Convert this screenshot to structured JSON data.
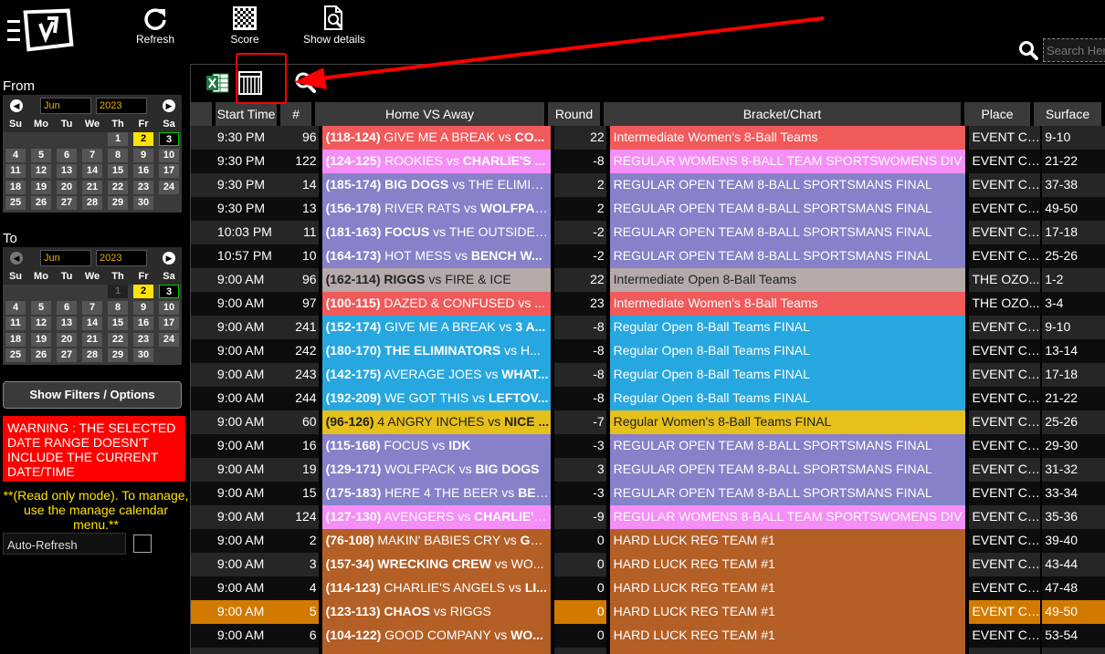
{
  "toolbar": {
    "refresh_label": "Refresh",
    "score_label": "Score",
    "details_label": "Show details",
    "search_placeholder": "Search Here"
  },
  "sidebar": {
    "from_label": "From",
    "to_label": "To",
    "from_calendar": {
      "month": "Jun",
      "year": "2023",
      "days_of_week": [
        "Su",
        "Mo",
        "Tu",
        "We",
        "Th",
        "Fr",
        "Sa"
      ],
      "weeks": [
        [
          "",
          "",
          "",
          "",
          "1",
          "2",
          "3"
        ],
        [
          "4",
          "5",
          "6",
          "7",
          "8",
          "9",
          "10"
        ],
        [
          "11",
          "12",
          "13",
          "14",
          "15",
          "16",
          "17"
        ],
        [
          "18",
          "19",
          "20",
          "21",
          "22",
          "23",
          "24"
        ],
        [
          "25",
          "26",
          "27",
          "28",
          "29",
          "30",
          ""
        ]
      ],
      "selected_day": "3",
      "today_day": "2"
    },
    "to_calendar": {
      "month": "Jun",
      "year": "2023",
      "days_of_week": [
        "Su",
        "Mo",
        "Tu",
        "We",
        "Th",
        "Fr",
        "Sa"
      ],
      "weeks": [
        [
          "",
          "",
          "",
          "",
          "1",
          "2",
          "3"
        ],
        [
          "4",
          "5",
          "6",
          "7",
          "8",
          "9",
          "10"
        ],
        [
          "11",
          "12",
          "13",
          "14",
          "15",
          "16",
          "17"
        ],
        [
          "18",
          "19",
          "20",
          "21",
          "22",
          "23",
          "24"
        ],
        [
          "25",
          "26",
          "27",
          "28",
          "29",
          "30",
          ""
        ]
      ],
      "selected_day": "3",
      "today_day": "2"
    },
    "filters_button": "Show Filters / Options",
    "warning": "WARNING : THE SELECTED DATE RANGE DOESN'T INCLUDE THE CURRENT DATE/TIME",
    "readonly_note": "**(Read only mode). To manage, use the manage calendar menu.**",
    "autorefresh_label": "Auto-Refresh"
  },
  "table": {
    "headers": [
      "",
      "Start Time",
      "#",
      "Home VS Away",
      "Round",
      "Bracket/Chart",
      "Place",
      "Surface"
    ],
    "rows": [
      {
        "time": "9:30 PM",
        "num": "96",
        "ids": "(118-124)",
        "home": "GIVE ME A BREAK",
        "vs": "vs",
        "away": "CO...",
        "round": "22",
        "bracket": "Intermediate Women's 8-Ball Teams",
        "place": "EVENT CE...",
        "surface": "9-10",
        "color": "#f05a5a",
        "bold": "away"
      },
      {
        "time": "9:30 PM",
        "num": "122",
        "ids": "(124-125)",
        "home": "ROOKIES",
        "vs": "vs",
        "away": "CHARLIE'S ...",
        "round": "-8",
        "bracket": "REGULAR WOMENS 8-BALL TEAM SPORTSWOMENS DIV",
        "place": "EVENT CE...",
        "surface": "21-22",
        "color": "#f58ef7",
        "bold": "away"
      },
      {
        "time": "9:30 PM",
        "num": "14",
        "ids": "(185-174)",
        "home": "BIG DOGS",
        "vs": "vs",
        "away": "THE ELIMIN...",
        "round": "2",
        "bracket": "REGULAR OPEN TEAM 8-BALL SPORTSMANS FINAL",
        "place": "EVENT CE...",
        "surface": "37-38",
        "color": "#8681c9",
        "bold": "home"
      },
      {
        "time": "9:30 PM",
        "num": "13",
        "ids": "(156-178)",
        "home": "RIVER RATS",
        "vs": "vs",
        "away": "WOLFPACK",
        "round": "2",
        "bracket": "REGULAR OPEN TEAM 8-BALL SPORTSMANS FINAL",
        "place": "EVENT CE...",
        "surface": "49-50",
        "color": "#8681c9",
        "bold": "away"
      },
      {
        "time": "10:03 PM",
        "num": "11",
        "ids": "(181-163)",
        "home": "FOCUS",
        "vs": "vs",
        "away": "THE OUTSIDERS",
        "round": "-2",
        "bracket": "REGULAR OPEN TEAM 8-BALL SPORTSMANS FINAL",
        "place": "EVENT CE...",
        "surface": "17-18",
        "color": "#8681c9",
        "bold": "home"
      },
      {
        "time": "10:57 PM",
        "num": "10",
        "ids": "(164-173)",
        "home": "HOT MESS",
        "vs": "vs",
        "away": "BENCH W...",
        "round": "-2",
        "bracket": "REGULAR OPEN TEAM 8-BALL SPORTSMANS FINAL",
        "place": "EVENT CE...",
        "surface": "25-26",
        "color": "#8681c9",
        "bold": "away"
      },
      {
        "time": "9:00 AM",
        "num": "96",
        "ids": "(162-114)",
        "home": "RIGGS",
        "vs": "vs",
        "away": "FIRE & ICE",
        "round": "22",
        "bracket": "Intermediate Open 8-Ball Teams",
        "place": "THE OZO...",
        "surface": "1-2",
        "color": "#b6a9a9",
        "bold": "home",
        "dark": true
      },
      {
        "time": "9:00 AM",
        "num": "97",
        "ids": "(100-115)",
        "home": "DAZED & CONFUSED",
        "vs": "vs",
        "away": "...",
        "round": "23",
        "bracket": "Intermediate Women's 8-Ball Teams",
        "place": "THE OZO...",
        "surface": "3-4",
        "color": "#f05a5a",
        "bold": "none"
      },
      {
        "time": "9:00 AM",
        "num": "241",
        "ids": "(152-174)",
        "home": "GIVE ME A BREAK",
        "vs": "vs",
        "away": "3 A...",
        "round": "-8",
        "bracket": "Regular Open 8-Ball Teams FINAL",
        "place": "EVENT CE...",
        "surface": "9-10",
        "color": "#27a7e0",
        "bold": "away"
      },
      {
        "time": "9:00 AM",
        "num": "242",
        "ids": "(180-170)",
        "home": "THE ELIMINATORS",
        "vs": "vs",
        "away": "H...",
        "round": "-8",
        "bracket": "Regular Open 8-Ball Teams FINAL",
        "place": "EVENT CE...",
        "surface": "13-14",
        "color": "#27a7e0",
        "bold": "home"
      },
      {
        "time": "9:00 AM",
        "num": "243",
        "ids": "(142-175)",
        "home": "AVERAGE JOES",
        "vs": "vs",
        "away": "WHAT...",
        "round": "-8",
        "bracket": "Regular Open 8-Ball Teams FINAL",
        "place": "EVENT CE...",
        "surface": "17-18",
        "color": "#27a7e0",
        "bold": "away"
      },
      {
        "time": "9:00 AM",
        "num": "244",
        "ids": "(192-209)",
        "home": "WE GOT THIS",
        "vs": "vs",
        "away": "LEFTOV...",
        "round": "-8",
        "bracket": "Regular Open 8-Ball Teams FINAL",
        "place": "EVENT CE...",
        "surface": "21-22",
        "color": "#27a7e0",
        "bold": "away"
      },
      {
        "time": "9:00 AM",
        "num": "60",
        "ids": "(96-126)",
        "home": "4 ANGRY INCHES",
        "vs": "vs",
        "away": "NICE ...",
        "round": "-7",
        "bracket": "Regular Women's 8-Ball Teams FINAL",
        "place": "EVENT CE...",
        "surface": "25-26",
        "color": "#e6c01b",
        "bold": "away",
        "dark": true
      },
      {
        "time": "9:00 AM",
        "num": "16",
        "ids": "(115-168)",
        "home": "FOCUS",
        "vs": "vs",
        "away": "IDK",
        "round": "-3",
        "bracket": "REGULAR OPEN TEAM 8-BALL SPORTSMANS FINAL",
        "place": "EVENT CE...",
        "surface": "29-30",
        "color": "#8681c9",
        "bold": "away"
      },
      {
        "time": "9:00 AM",
        "num": "19",
        "ids": "(129-171)",
        "home": "WOLFPACK",
        "vs": "vs",
        "away": "BIG DOGS",
        "round": "3",
        "bracket": "REGULAR OPEN TEAM 8-BALL SPORTSMANS FINAL",
        "place": "EVENT CE...",
        "surface": "31-32",
        "color": "#8681c9",
        "bold": "away"
      },
      {
        "time": "9:00 AM",
        "num": "15",
        "ids": "(175-183)",
        "home": "HERE 4 THE BEER",
        "vs": "vs",
        "away": "BEN...",
        "round": "-3",
        "bracket": "REGULAR OPEN TEAM 8-BALL SPORTSMANS FINAL",
        "place": "EVENT CE...",
        "surface": "33-34",
        "color": "#8681c9",
        "bold": "away"
      },
      {
        "time": "9:00 AM",
        "num": "124",
        "ids": "(127-130)",
        "home": "AVENGERS",
        "vs": "vs",
        "away": "CHARLIE'S...",
        "round": "-9",
        "bracket": "REGULAR WOMENS 8-BALL TEAM SPORTSWOMENS DIV",
        "place": "EVENT CE...",
        "surface": "35-36",
        "color": "#f58ef7",
        "bold": "away"
      },
      {
        "time": "9:00 AM",
        "num": "2",
        "ids": "(76-108)",
        "home": "MAKIN' BABIES CRY",
        "vs": "vs",
        "away": "GO...",
        "round": "0",
        "bracket": "HARD LUCK REG TEAM #1",
        "place": "EVENT CE...",
        "surface": "39-40",
        "color": "#b45f26",
        "bold": "away"
      },
      {
        "time": "9:00 AM",
        "num": "3",
        "ids": "(157-34)",
        "home": "WRECKING CREW",
        "vs": "vs",
        "away": "WO...",
        "round": "0",
        "bracket": "HARD LUCK REG TEAM #1",
        "place": "EVENT CE...",
        "surface": "43-44",
        "color": "#b45f26",
        "bold": "home"
      },
      {
        "time": "9:00 AM",
        "num": "4",
        "ids": "(114-123)",
        "home": "CHARLIE'S ANGELS",
        "vs": "vs",
        "away": "LI...",
        "round": "0",
        "bracket": "HARD LUCK REG TEAM #1",
        "place": "EVENT CE...",
        "surface": "47-48",
        "color": "#b45f26",
        "bold": "away"
      },
      {
        "time": "9:00 AM",
        "num": "5",
        "ids": "(123-113)",
        "home": "CHAOS",
        "vs": "vs",
        "away": "RIGGS",
        "round": "0",
        "bracket": "HARD LUCK REG TEAM #1",
        "place": "EVENT CE...",
        "surface": "49-50",
        "color": "#b45f26",
        "bold": "home",
        "highlight": true
      },
      {
        "time": "9:00 AM",
        "num": "6",
        "ids": "(104-122)",
        "home": "GOOD COMPANY",
        "vs": "vs",
        "away": "WO...",
        "round": "0",
        "bracket": "HARD LUCK REG TEAM #1",
        "place": "EVENT CE...",
        "surface": "53-54",
        "color": "#b45f26",
        "bold": "away"
      },
      {
        "time": "",
        "num": "",
        "ids": "",
        "home": "",
        "vs": "",
        "away": "",
        "round": "",
        "bracket": "",
        "place": "",
        "surface": "",
        "color": "#b45f26",
        "bold": "none"
      }
    ]
  },
  "colors": {
    "accent_highlight": "#d27a00",
    "warning_bg": "#ff0000",
    "annotation_arrow": "#ff0000"
  }
}
